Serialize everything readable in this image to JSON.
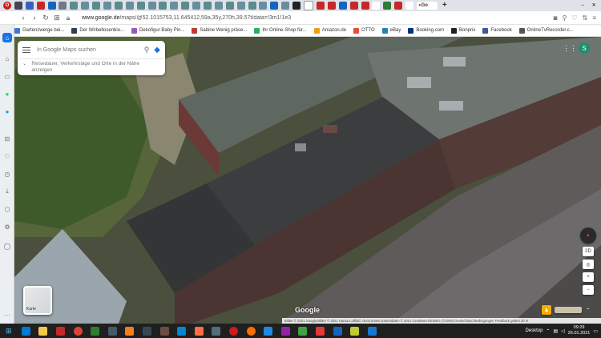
{
  "browser": {
    "active_tab_label": "Go",
    "url_host": "www.google.de",
    "url_path": "/maps/@52.1015753,11.645412,59a,35y,270h,39.57t/data=!3m1!1e3"
  },
  "bookmarks": [
    {
      "label": "Gartenzwerge bei...",
      "color": "#3a7bd5"
    },
    {
      "label": "Der Wirbellosenbio...",
      "color": "#2c3e50"
    },
    {
      "label": "Dekofigur Baby Pin...",
      "color": "#9b59b6"
    },
    {
      "label": "Sabine Wenig präse...",
      "color": "#c0392b"
    },
    {
      "label": "Ihr Online-Shop für...",
      "color": "#27ae60"
    },
    {
      "label": "Amazon.de",
      "color": "#f39c12"
    },
    {
      "label": "OTTO",
      "color": "#e74c3c"
    },
    {
      "label": "eBay",
      "color": "#2980b9"
    },
    {
      "label": "Booking.com",
      "color": "#003580"
    },
    {
      "label": "Bonprix",
      "color": "#222222"
    },
    {
      "label": "Facebook",
      "color": "#3b5998"
    },
    {
      "label": "OnlineTvRecorder.c...",
      "color": "#555555"
    }
  ],
  "search": {
    "placeholder": "In Google Maps suchen",
    "directions_hint": "Reisedauer, Verkehrslage und Orte in der Nähe anzeigen"
  },
  "map": {
    "layer_label": "Karte",
    "logo": "Google",
    "attribution": "Bilder © 2021 Google,Bilder © 2021 Hansa Luftbild, GeoContent,Kartendaten © 2021 GeoBasis-DE/BKG (©2009)   Deutschland   Bedingungen   Feedback geben   20 m",
    "view_label": "2D",
    "avatar_letter": "S"
  },
  "taskbar": {
    "desktop_label": "Desktop",
    "time": "09:29",
    "date": "26.01.2021"
  },
  "colors": {
    "opera_red": "#cc1b1b",
    "maps_blue": "#1a73e8"
  }
}
